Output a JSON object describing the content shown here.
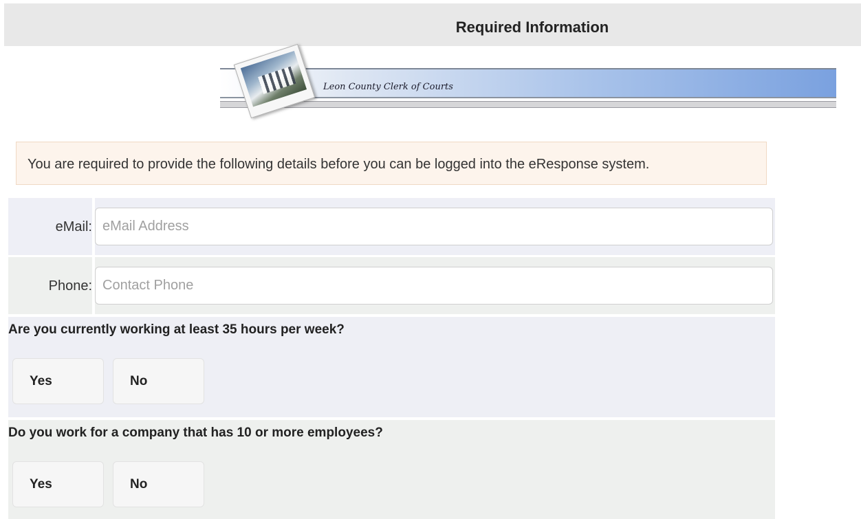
{
  "header": {
    "title": "Required Information"
  },
  "banner": {
    "caption": "Leon County Clerk of Courts"
  },
  "notice": {
    "text": "You are required to provide the following details before you can be logged into the eResponse system."
  },
  "form": {
    "email": {
      "label": "eMail:",
      "placeholder": "eMail Address",
      "value": ""
    },
    "phone": {
      "label": "Phone:",
      "placeholder": "Contact Phone",
      "value": ""
    }
  },
  "questions": [
    {
      "text": "Are you currently working at least 35 hours per week?",
      "yes_label": "Yes",
      "no_label": "No"
    },
    {
      "text": "Do you work for a company that has 10 or more employees?",
      "yes_label": "Yes",
      "no_label": "No"
    }
  ],
  "colors": {
    "header_bg": "#e8e8e8",
    "notice_bg": "#fdf4ec",
    "notice_border": "#f0d9c4",
    "row_bg": "#eeeff6"
  }
}
